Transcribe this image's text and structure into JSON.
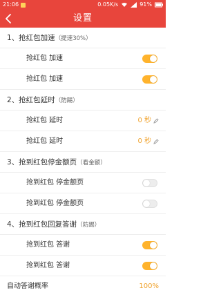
{
  "status_bar": {
    "time": "21:06",
    "network_speed": "0.05K/s",
    "battery": "91%"
  },
  "header": {
    "title": "设置"
  },
  "sections": [
    {
      "title": "1、抢红包加速",
      "note": "（提速30%）",
      "rows": [
        {
          "label": "抢红包 加速",
          "control": "toggle",
          "on": true
        },
        {
          "label": "抢红包 加速",
          "control": "toggle",
          "on": true
        }
      ]
    },
    {
      "title": "2、抢红包延时",
      "note": "（防踢）",
      "rows": [
        {
          "label": "抢红包 延时",
          "control": "value",
          "value": "0 秒"
        },
        {
          "label": "抢红包 延时",
          "control": "value",
          "value": "0 秒"
        }
      ]
    },
    {
      "title": "3、抢到红包停金额页",
      "note": "（看金额）",
      "rows": [
        {
          "label": "抢到红包 停金额页",
          "control": "toggle",
          "on": false
        },
        {
          "label": "抢到红包 停金额页",
          "control": "toggle",
          "on": false
        }
      ]
    },
    {
      "title": "4、抢到红包回复答谢",
      "note": "（防踢）",
      "rows": [
        {
          "label": "抢到红包 答谢",
          "control": "toggle",
          "on": true
        },
        {
          "label": "抢到红包 答谢",
          "control": "toggle",
          "on": true
        }
      ]
    }
  ],
  "partial_row": {
    "label": "自动答谢概率",
    "value": "100%"
  },
  "colors": {
    "brand": "#e8453c",
    "toggle_on": "#ffb32c",
    "value_text": "#f0a22c"
  }
}
